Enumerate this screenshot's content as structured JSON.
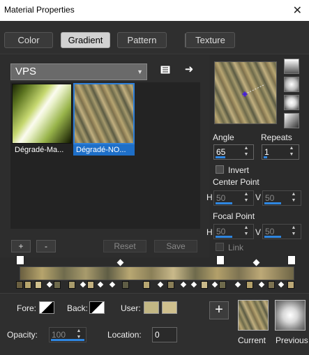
{
  "window": {
    "title": "Material Properties",
    "close_glyph": "✕"
  },
  "tabs": [
    {
      "label": "Color",
      "active": false
    },
    {
      "label": "Gradient",
      "active": true
    },
    {
      "label": "Pattern",
      "active": false
    },
    {
      "label": "Texture",
      "active": false
    }
  ],
  "library": {
    "category": "VPS",
    "items": [
      {
        "label": "Dégradé-Ma...",
        "selected": false
      },
      {
        "label": "Dégradé-NO...",
        "selected": true
      }
    ],
    "buttons": {
      "add": "+",
      "remove": "-",
      "reset": "Reset",
      "save": "Save"
    }
  },
  "settings": {
    "angle_label": "Angle",
    "angle_value": "65",
    "repeats_label": "Repeats",
    "repeats_value": "1",
    "invert_label": "Invert",
    "invert_checked": false,
    "center_point_label": "Center Point",
    "center_h_label": "H",
    "center_h_value": "50",
    "center_v_label": "V",
    "center_v_value": "50",
    "focal_point_label": "Focal Point",
    "focal_h_label": "H",
    "focal_h_value": "50",
    "focal_v_label": "V",
    "focal_v_value": "50",
    "link_label": "Link",
    "link_checked": false
  },
  "bottom": {
    "fore_label": "Fore:",
    "back_label": "Back:",
    "user_label": "User:",
    "user_colors": [
      "#c2b784",
      "#cfc08e"
    ],
    "opacity_label": "Opacity:",
    "opacity_value": "100",
    "location_label": "Location:",
    "location_value": "0",
    "current_label": "Current",
    "previous_label": "Previous"
  },
  "colors": {
    "accent": "#1e6fc8",
    "background": "#2b2b2b"
  }
}
